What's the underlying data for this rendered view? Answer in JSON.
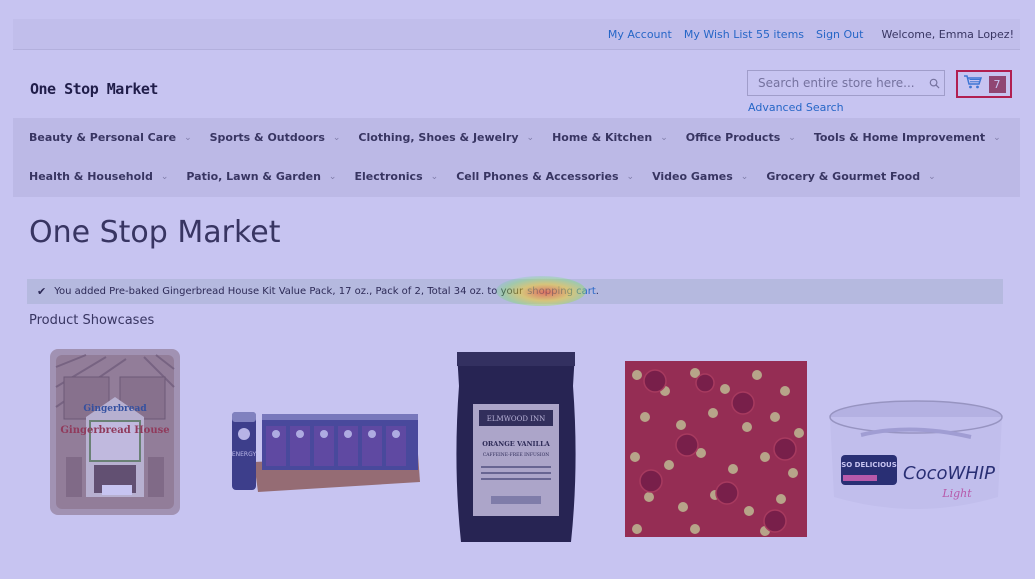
{
  "topbar": {
    "my_account": "My Account",
    "wish_list": "My Wish List 55 items",
    "sign_out": "Sign Out",
    "welcome": "Welcome, Emma Lopez!"
  },
  "header": {
    "logo": "One Stop Market",
    "search_placeholder": "Search entire store here...",
    "advanced_search": "Advanced Search",
    "cart_count": "7"
  },
  "nav": {
    "row1": [
      {
        "label": "Beauty & Personal Care"
      },
      {
        "label": "Sports & Outdoors"
      },
      {
        "label": "Clothing, Shoes & Jewelry"
      },
      {
        "label": "Home & Kitchen"
      },
      {
        "label": "Office Products"
      },
      {
        "label": "Tools & Home Improvement"
      }
    ],
    "row2": [
      {
        "label": "Health & Household"
      },
      {
        "label": "Patio, Lawn & Garden"
      },
      {
        "label": "Electronics"
      },
      {
        "label": "Cell Phones & Accessories"
      },
      {
        "label": "Video Games"
      },
      {
        "label": "Grocery & Gourmet Food"
      }
    ]
  },
  "main": {
    "title": "One Stop Market",
    "message_text": "You added Pre-baked Gingerbread House Kit Value Pack, 17 oz., Pack of 2, Total 34 oz. to your",
    "message_link": "shopping cart",
    "message_end": ".",
    "showcase_label": "Product Showcases"
  },
  "products": [
    {
      "icon": "gingerbread-house-kit-image",
      "label": "Gingerbread House"
    },
    {
      "icon": "energy-drink-pack-image",
      "label": "ENERGY"
    },
    {
      "icon": "orange-vanilla-tea-bag-image",
      "label": "ORANGE VANILLA",
      "sublabel": "CAFFEINE-FREE INFUSION",
      "brand": "ELMWOOD INN"
    },
    {
      "icon": "rose-sprinkles-image"
    },
    {
      "icon": "coco-whip-tub-image",
      "label": "CocoWHIP",
      "brand": "SO DELICIOUS",
      "sublabel": "Light"
    }
  ],
  "colors": {
    "link": "#1979c3",
    "cart_border": "#e0131a",
    "cart_count_bg": "#b14b4b",
    "success_bg": "#e5efe5",
    "overlay": "#463cd2"
  }
}
